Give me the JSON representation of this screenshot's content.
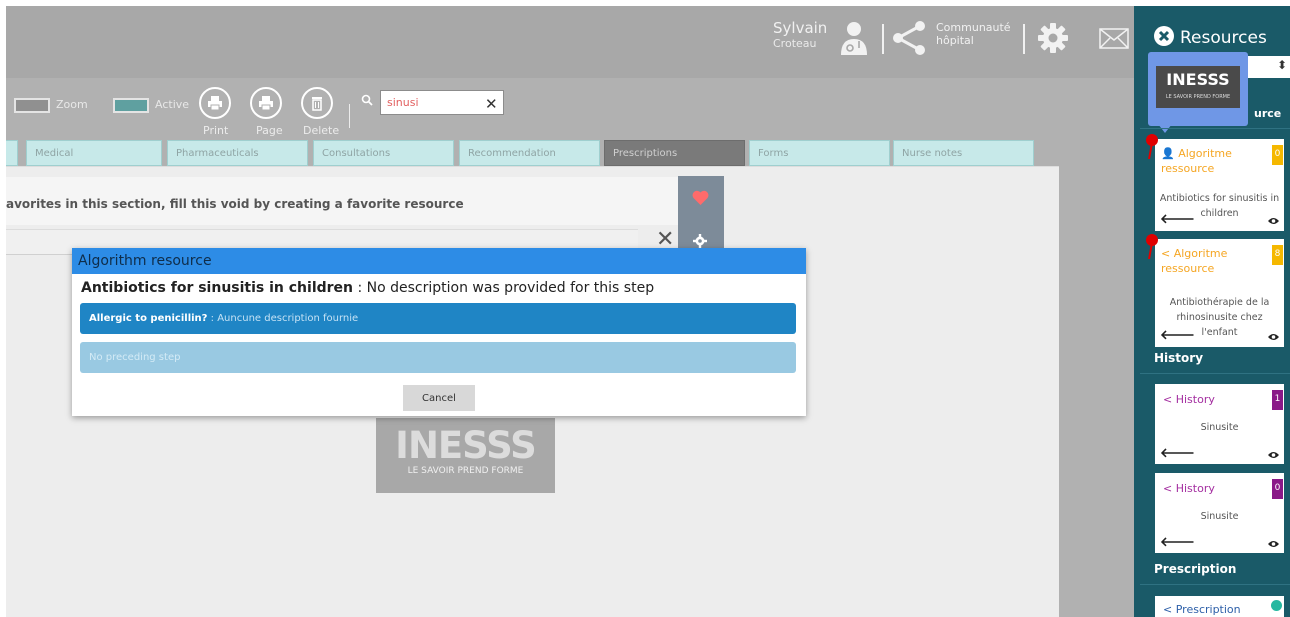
{
  "colors": {
    "accent": "#2d8ce6",
    "panel": "#1a5a68",
    "orange_badge": "#f5b800",
    "purple_badge": "#8a1a88",
    "pin": "#e00000"
  },
  "topbar": {
    "user_first": "Sylvain",
    "user_last": "Croteau",
    "community_line1": "Communauté",
    "community_line2": "hôpital"
  },
  "toolbar": {
    "zoom_label": "Zoom",
    "active_label": "Active",
    "print_label": "Print",
    "page_label": "Page",
    "delete_label": "Delete",
    "search_value": "sinusi"
  },
  "tabs": [
    {
      "label": "Medical"
    },
    {
      "label": "Pharmaceuticals"
    },
    {
      "label": "Consultations"
    },
    {
      "label": "Recommendation"
    },
    {
      "label": "Prescriptions"
    },
    {
      "label": "Forms"
    },
    {
      "label": "Nurse notes"
    }
  ],
  "content": {
    "favorites_message": "avorites in this section, fill this void by creating a favorite resource",
    "logo_text": "INESSS",
    "logo_subtitle": "LE SAVOIR PREND FORME"
  },
  "modal": {
    "title": "Algorithm resource",
    "question_bold": "Antibiotics for sinusitis in children",
    "question_rest": " : No description was provided for this step",
    "option1_bold": "Allergic to penicillin?",
    "option1_rest": " : Auncune description fournie",
    "option2": "No preceding step",
    "cancel_label": "Cancel"
  },
  "panel": {
    "title": "Resources",
    "tooltip_logo": "INESSS",
    "tooltip_subtitle": "LE SAVOIR PREND FORME",
    "partial_heading": "urce",
    "cards": [
      {
        "title_line1": "Algoritme",
        "title_line2": "ressource",
        "badge": "0",
        "desc_line1": "Antibiotics for sinusitis in",
        "desc_line2": "children"
      },
      {
        "title_line1": "Algoritme",
        "title_line2": "ressource",
        "badge": "8",
        "desc_line1": "Antibiothérapie de la",
        "desc_line2": "rhinosinusite chez",
        "desc_line3": "l'enfant"
      }
    ],
    "history_heading": "History",
    "history_cards": [
      {
        "title": "History",
        "badge": "1",
        "desc": "Sinusite"
      },
      {
        "title": "History",
        "badge": "0",
        "desc": "Sinusite"
      }
    ],
    "prescription_heading": "Prescription",
    "prescription_card": {
      "title": "Prescription"
    }
  }
}
